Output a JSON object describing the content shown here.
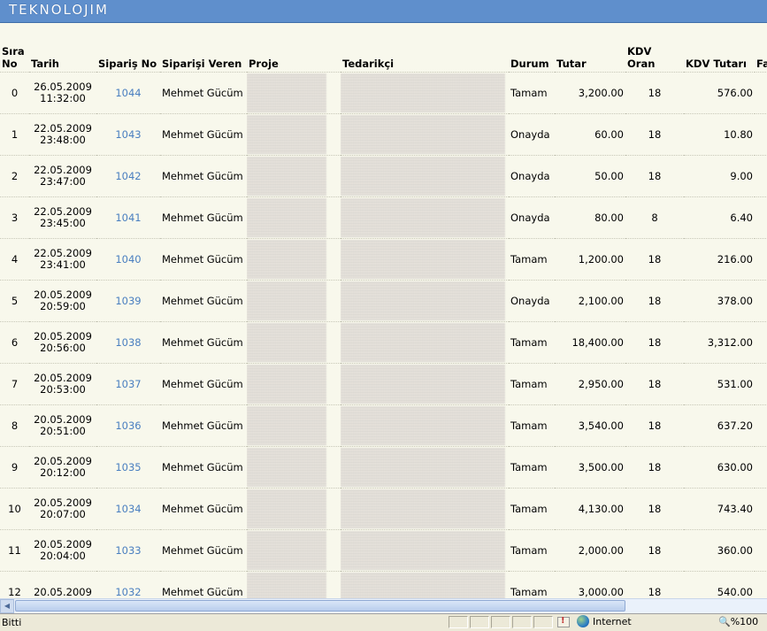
{
  "banner": {
    "logo": "TEKNOLOJIM"
  },
  "columns": [
    "Sıra No",
    "Tarih",
    "Sipariş No",
    "Siparişi Veren",
    "Proje",
    "Tedarikçi",
    "Durum",
    "Tutar",
    "KDV Oran",
    "KDV Tutarı",
    "Fa"
  ],
  "rows": [
    {
      "sira": "0",
      "date": "26.05.2009",
      "time": "11:32:00",
      "no": "1044",
      "veren": "Mehmet Gücüm",
      "durum": "Tamam",
      "tutar": "3,200.00",
      "oran": "18",
      "kdv": "576.00"
    },
    {
      "sira": "1",
      "date": "22.05.2009",
      "time": "23:48:00",
      "no": "1043",
      "veren": "Mehmet Gücüm",
      "durum": "Onayda",
      "tutar": "60.00",
      "oran": "18",
      "kdv": "10.80"
    },
    {
      "sira": "2",
      "date": "22.05.2009",
      "time": "23:47:00",
      "no": "1042",
      "veren": "Mehmet Gücüm",
      "durum": "Onayda",
      "tutar": "50.00",
      "oran": "18",
      "kdv": "9.00"
    },
    {
      "sira": "3",
      "date": "22.05.2009",
      "time": "23:45:00",
      "no": "1041",
      "veren": "Mehmet Gücüm",
      "durum": "Onayda",
      "tutar": "80.00",
      "oran": "8",
      "kdv": "6.40"
    },
    {
      "sira": "4",
      "date": "22.05.2009",
      "time": "23:41:00",
      "no": "1040",
      "veren": "Mehmet Gücüm",
      "durum": "Tamam",
      "tutar": "1,200.00",
      "oran": "18",
      "kdv": "216.00"
    },
    {
      "sira": "5",
      "date": "20.05.2009",
      "time": "20:59:00",
      "no": "1039",
      "veren": "Mehmet Gücüm",
      "durum": "Onayda",
      "tutar": "2,100.00",
      "oran": "18",
      "kdv": "378.00"
    },
    {
      "sira": "6",
      "date": "20.05.2009",
      "time": "20:56:00",
      "no": "1038",
      "veren": "Mehmet Gücüm",
      "durum": "Tamam",
      "tutar": "18,400.00",
      "oran": "18",
      "kdv": "3,312.00"
    },
    {
      "sira": "7",
      "date": "20.05.2009",
      "time": "20:53:00",
      "no": "1037",
      "veren": "Mehmet Gücüm",
      "durum": "Tamam",
      "tutar": "2,950.00",
      "oran": "18",
      "kdv": "531.00"
    },
    {
      "sira": "8",
      "date": "20.05.2009",
      "time": "20:51:00",
      "no": "1036",
      "veren": "Mehmet Gücüm",
      "durum": "Tamam",
      "tutar": "3,540.00",
      "oran": "18",
      "kdv": "637.20"
    },
    {
      "sira": "9",
      "date": "20.05.2009",
      "time": "20:12:00",
      "no": "1035",
      "veren": "Mehmet Gücüm",
      "durum": "Tamam",
      "tutar": "3,500.00",
      "oran": "18",
      "kdv": "630.00"
    },
    {
      "sira": "10",
      "date": "20.05.2009",
      "time": "20:07:00",
      "no": "1034",
      "veren": "Mehmet Gücüm",
      "durum": "Tamam",
      "tutar": "4,130.00",
      "oran": "18",
      "kdv": "743.40"
    },
    {
      "sira": "11",
      "date": "20.05.2009",
      "time": "20:04:00",
      "no": "1033",
      "veren": "Mehmet Gücüm",
      "durum": "Tamam",
      "tutar": "2,000.00",
      "oran": "18",
      "kdv": "360.00"
    },
    {
      "sira": "12",
      "date": "20.05.2009",
      "time": "",
      "no": "1032",
      "veren": "Mehmet Gücüm",
      "durum": "Tamam",
      "tutar": "3,000.00",
      "oran": "18",
      "kdv": "540.00"
    }
  ],
  "status": {
    "text": "Bitti",
    "zone": "Internet",
    "zoom": "%100"
  },
  "colors": {
    "banner": "#5f8fcc",
    "link": "#4a7fc0",
    "background": "#f8f8ec"
  }
}
